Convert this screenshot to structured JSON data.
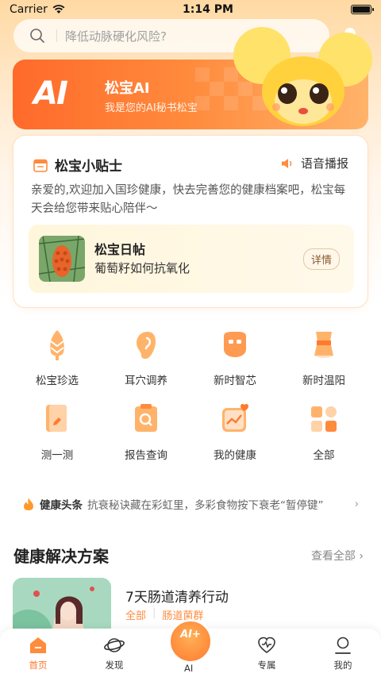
{
  "status_bar": {
    "carrier": "Carrier",
    "time": "1:14 PM"
  },
  "search": {
    "placeholder": "降低动脉硬化风险?"
  },
  "ai_banner": {
    "logo": "AI",
    "title": "松宝AI",
    "subtitle": "我是您的AI秘书松宝"
  },
  "tips": {
    "title": "松宝小贴士",
    "voice_label": "语音播报",
    "text": "亲爱的,欢迎加入国珍健康，快去完善您的健康档案吧，松宝每天会给您带来贴心陪伴～",
    "daily": {
      "title": "松宝日帖",
      "subtitle": "葡萄籽如何抗氧化",
      "detail_label": "详情"
    }
  },
  "grid": [
    {
      "label": "松宝珍选",
      "icon": "pine-cone-icon"
    },
    {
      "label": "耳穴调养",
      "icon": "ear-icon"
    },
    {
      "label": "新时智芯",
      "icon": "chip-icon"
    },
    {
      "label": "新时温阳",
      "icon": "warm-belt-icon"
    },
    {
      "label": "测一测",
      "icon": "test-book-icon"
    },
    {
      "label": "报告查询",
      "icon": "report-search-icon"
    },
    {
      "label": "我的健康",
      "icon": "health-chart-icon"
    },
    {
      "label": "全部",
      "icon": "all-apps-icon"
    }
  ],
  "news": {
    "tag": "健康头条",
    "text": "抗衰秘诀藏在彩虹里，多彩食物按下衰老“暂停键”"
  },
  "solutions": {
    "title": "健康解决方案",
    "view_all": "查看全部",
    "card": {
      "name": "7天肠道清养行动",
      "tags": [
        "全部",
        "肠道菌群"
      ]
    }
  },
  "tabbar": {
    "tabs": [
      {
        "label": "首页",
        "icon": "home-icon"
      },
      {
        "label": "发现",
        "icon": "planet-icon"
      },
      {
        "label": "AI",
        "icon": "ai-mascot-icon"
      },
      {
        "label": "专属",
        "icon": "heart-wave-icon"
      },
      {
        "label": "我的",
        "icon": "profile-icon"
      }
    ],
    "ai_badge": "AI+"
  },
  "colors": {
    "accent": "#ff7a2f",
    "banner": "#ff6a2a"
  }
}
